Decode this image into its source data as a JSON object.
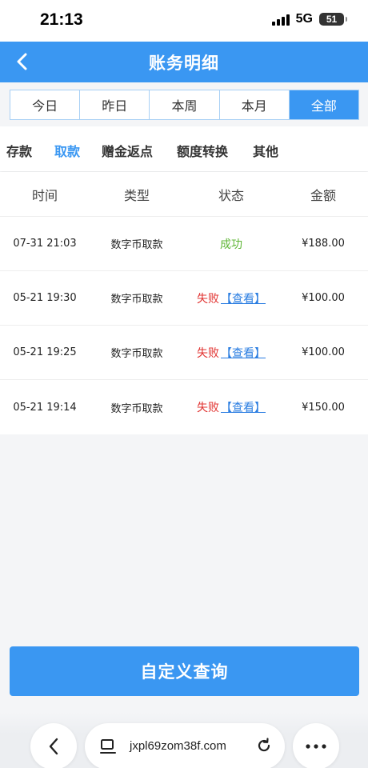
{
  "status_bar": {
    "time": "21:13",
    "network": "5G",
    "battery": "51"
  },
  "header": {
    "title": "账务明细"
  },
  "date_tabs": [
    {
      "label": "今日",
      "active": false
    },
    {
      "label": "昨日",
      "active": false
    },
    {
      "label": "本周",
      "active": false
    },
    {
      "label": "本月",
      "active": false
    },
    {
      "label": "全部",
      "active": true
    }
  ],
  "category_tabs": [
    {
      "label": "存款",
      "active": false
    },
    {
      "label": "取款",
      "active": true
    },
    {
      "label": "赠金返点",
      "active": false
    },
    {
      "label": "额度转换",
      "active": false
    },
    {
      "label": "其他",
      "active": false
    }
  ],
  "table": {
    "columns": [
      "时间",
      "类型",
      "状态",
      "金额"
    ],
    "rows": [
      {
        "time": "07-31 21:03",
        "type": "数字币取款",
        "status": "成功",
        "link": "",
        "amount": "¥188.00"
      },
      {
        "time": "05-21 19:30",
        "type": "数字币取款",
        "status": "失败",
        "link": "【查看】",
        "amount": "¥100.00"
      },
      {
        "time": "05-21 19:25",
        "type": "数字币取款",
        "status": "失败",
        "link": "【查看】",
        "amount": "¥100.00"
      },
      {
        "time": "05-21 19:14",
        "type": "数字币取款",
        "status": "失败",
        "link": "【查看】",
        "amount": "¥150.00"
      }
    ]
  },
  "custom_query_button": "自定义查询",
  "browser": {
    "url": "jxpl69zom38f.com"
  },
  "colors": {
    "primary": "#3a97f2",
    "success": "#5fb636",
    "fail": "#e0312f",
    "link": "#2a7de1"
  },
  "icons": [
    "back-icon",
    "signal-icon",
    "battery-icon",
    "browser-back-icon",
    "reader-icon",
    "reload-icon",
    "more-icon"
  ]
}
